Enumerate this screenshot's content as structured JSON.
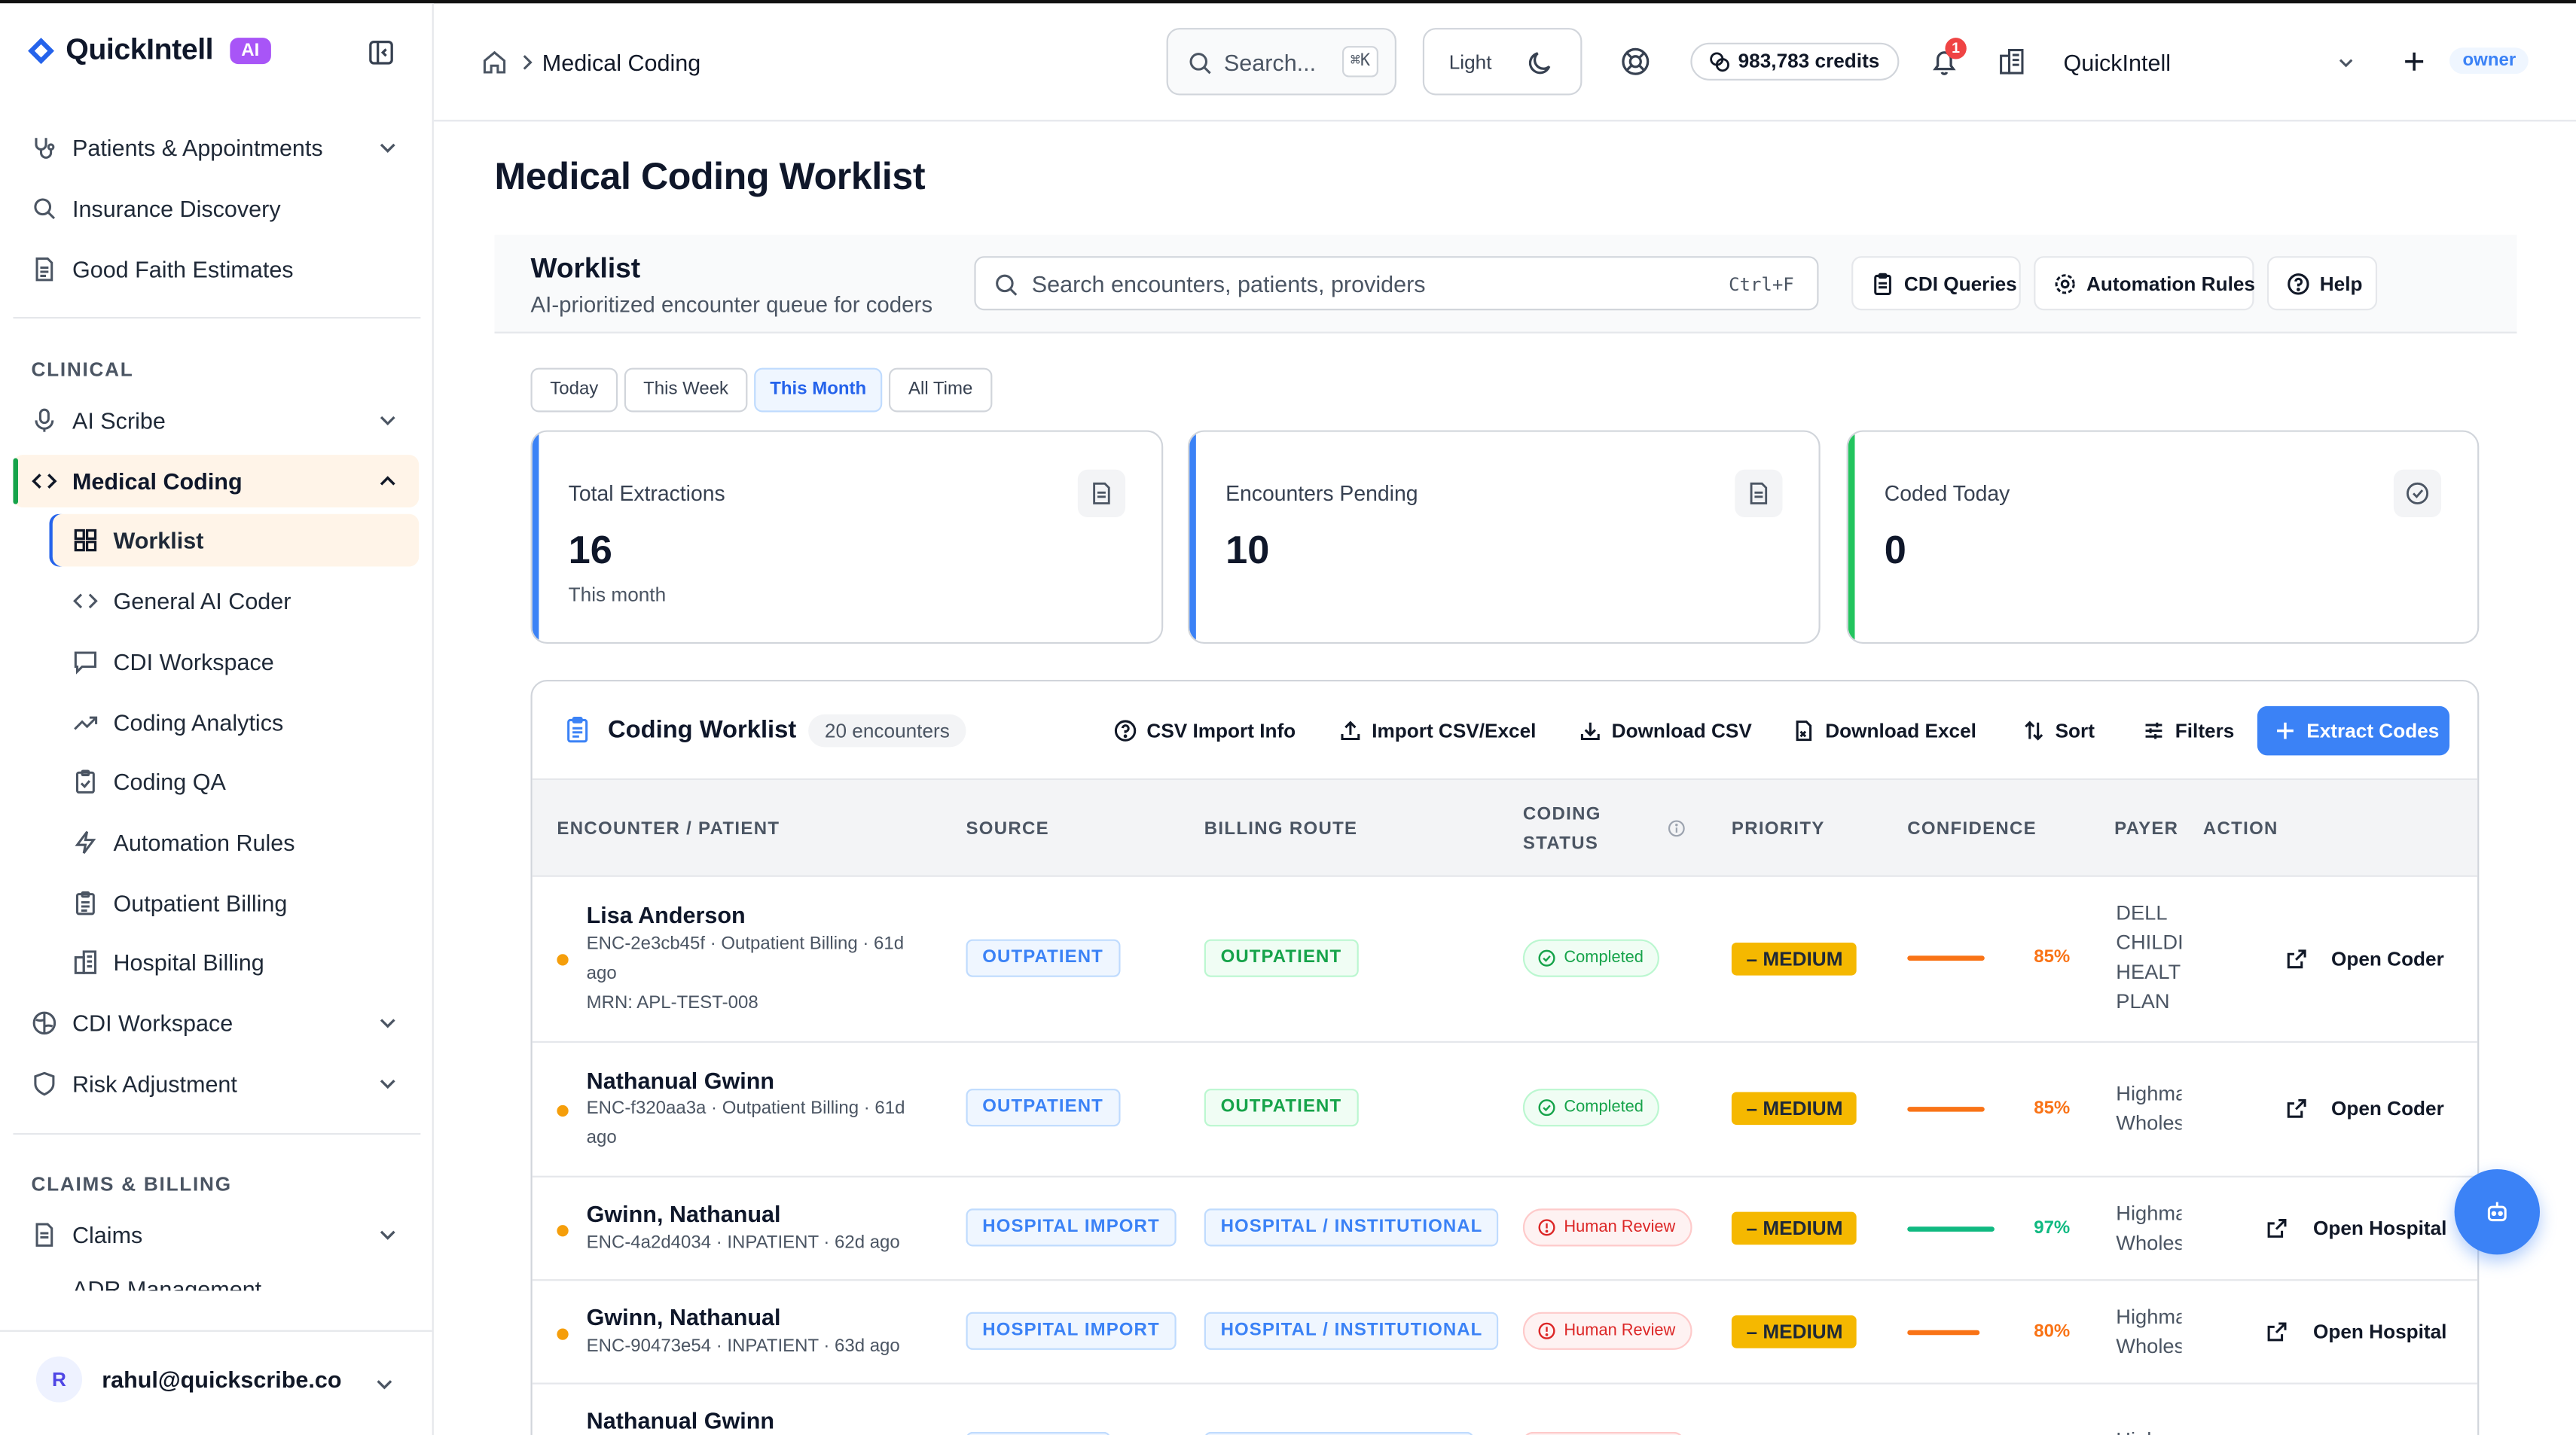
{
  "brand": {
    "name": "QuickIntell",
    "badge": "AI"
  },
  "sidebar": {
    "top_items": [
      {
        "label": "Patients & Appointments",
        "icon": "stethoscope-icon"
      },
      {
        "label": "Insurance Discovery",
        "icon": "search-icon"
      },
      {
        "label": "Good Faith Estimates",
        "icon": "document-icon"
      }
    ],
    "clinical_label": "CLINICAL",
    "ai_scribe": "AI Scribe",
    "medical_coding": "Medical Coding",
    "coding_sub": [
      {
        "label": "Worklist",
        "icon": "grid-icon"
      },
      {
        "label": "General AI Coder",
        "icon": "code-icon"
      },
      {
        "label": "CDI Workspace",
        "icon": "message-icon"
      },
      {
        "label": "Coding Analytics",
        "icon": "trending-icon"
      },
      {
        "label": "Coding QA",
        "icon": "clipboard-check-icon"
      },
      {
        "label": "Automation Rules",
        "icon": "lightning-icon"
      },
      {
        "label": "Outpatient Billing",
        "icon": "clipboard-icon"
      },
      {
        "label": "Hospital Billing",
        "icon": "building-icon"
      }
    ],
    "cdi_workspace": "CDI Workspace",
    "risk_adjustment": "Risk Adjustment",
    "claims_label": "CLAIMS & BILLING",
    "claims": "Claims",
    "cut_item": "ADR Management",
    "user": {
      "initial": "R",
      "email": "rahul@quickscribe.co"
    }
  },
  "header": {
    "breadcrumb": "Medical Coding",
    "search_placeholder": "Search...",
    "search_shortcut": "⌘K",
    "theme_label": "Light",
    "credits": "983,783 credits",
    "notification_count": "1",
    "org_name": "QuickIntell",
    "role": "owner"
  },
  "page": {
    "title": "Medical Coding Worklist",
    "worklist_title": "Worklist",
    "worklist_subtitle": "AI-prioritized encounter queue for coders",
    "search_placeholder": "Search encounters, patients, providers",
    "search_shortcut": "Ctrl+F",
    "buttons": {
      "cdi": "CDI Queries",
      "automation": "Automation Rules",
      "help": "Help"
    },
    "ranges": [
      "Today",
      "This Week",
      "This Month",
      "All Time"
    ],
    "active_range": "This Month"
  },
  "stats": [
    {
      "label": "Total Extractions",
      "value": "16",
      "sub": "This month",
      "accent": "#3b82f6"
    },
    {
      "label": "Encounters Pending",
      "value": "10",
      "sub": "",
      "accent": "#3b82f6"
    },
    {
      "label": "Coded Today",
      "value": "0",
      "sub": "",
      "accent": "#22c55e"
    }
  ],
  "table": {
    "title": "Coding Worklist",
    "count": "20 encounters",
    "buttons": {
      "csv_info": "CSV Import Info",
      "import": "Import CSV/Excel",
      "download_csv": "Download CSV",
      "download_excel": "Download Excel",
      "sort": "Sort",
      "filters": "Filters",
      "extract": "Extract Codes"
    },
    "columns": {
      "patient": "ENCOUNTER / PATIENT",
      "source": "SOURCE",
      "route": "BILLING ROUTE",
      "status_line1": "CODING",
      "status_line2": "STATUS",
      "priority": "PRIORITY",
      "confidence": "CONFIDENCE",
      "payer": "PAYER",
      "action": "ACTION"
    },
    "rows": [
      {
        "name": "Lisa Anderson",
        "meta1": "ENC-2e3cb45f · Outpatient Billing · 61d",
        "meta2": "ago",
        "meta3": "MRN: APL-TEST-008",
        "source": "OUTPATIENT",
        "route": "OUTPATIENT",
        "status": "Completed",
        "priority": "MEDIUM",
        "confidence": 85,
        "confidence_label": "85%",
        "payer_lines": [
          "DELL",
          "CHILDI",
          "HEALTI",
          "PLAN"
        ],
        "action": "Open Coder"
      },
      {
        "name": "Nathanual Gwinn",
        "meta1": "ENC-f320aa3a · Outpatient Billing · 61d",
        "meta2": "ago",
        "meta3": "",
        "source": "OUTPATIENT",
        "route": "OUTPATIENT",
        "status": "Completed",
        "priority": "MEDIUM",
        "confidence": 85,
        "confidence_label": "85%",
        "payer_lines": [
          "Highma",
          "Wholes"
        ],
        "action": "Open Coder"
      },
      {
        "name": "Gwinn, Nathanual",
        "meta1": "ENC-4a2d4034 · INPATIENT · 62d ago",
        "meta2": "",
        "meta3": "",
        "source": "HOSPITAL IMPORT",
        "route": "HOSPITAL / INSTITUTIONAL",
        "status": "Human Review",
        "priority": "MEDIUM",
        "confidence": 97,
        "confidence_label": "97%",
        "payer_lines": [
          "Highma",
          "Wholes"
        ],
        "action": "Open Hospital"
      },
      {
        "name": "Gwinn, Nathanual",
        "meta1": "ENC-90473e54 · INPATIENT · 63d ago",
        "meta2": "",
        "meta3": "",
        "source": "HOSPITAL IMPORT",
        "route": "HOSPITAL / INSTITUTIONAL",
        "status": "Human Review",
        "priority": "MEDIUM",
        "confidence": 80,
        "confidence_label": "80%",
        "payer_lines": [
          "Highma",
          "Wholes"
        ],
        "action": "Open Hospital"
      },
      {
        "name": "Nathanual Gwinn",
        "meta1": "",
        "meta2": "",
        "meta3": "",
        "source": "",
        "route": "",
        "status": "",
        "priority": "",
        "confidence": null,
        "confidence_label": "",
        "payer_lines": [
          "Highma"
        ],
        "action": ""
      }
    ]
  },
  "colors": {
    "primary": "#3b82f6",
    "success": "#16a34a",
    "danger": "#dc2626",
    "priority": "#f5b800",
    "conf_high": "#10b981",
    "conf_mid": "#f97316"
  }
}
